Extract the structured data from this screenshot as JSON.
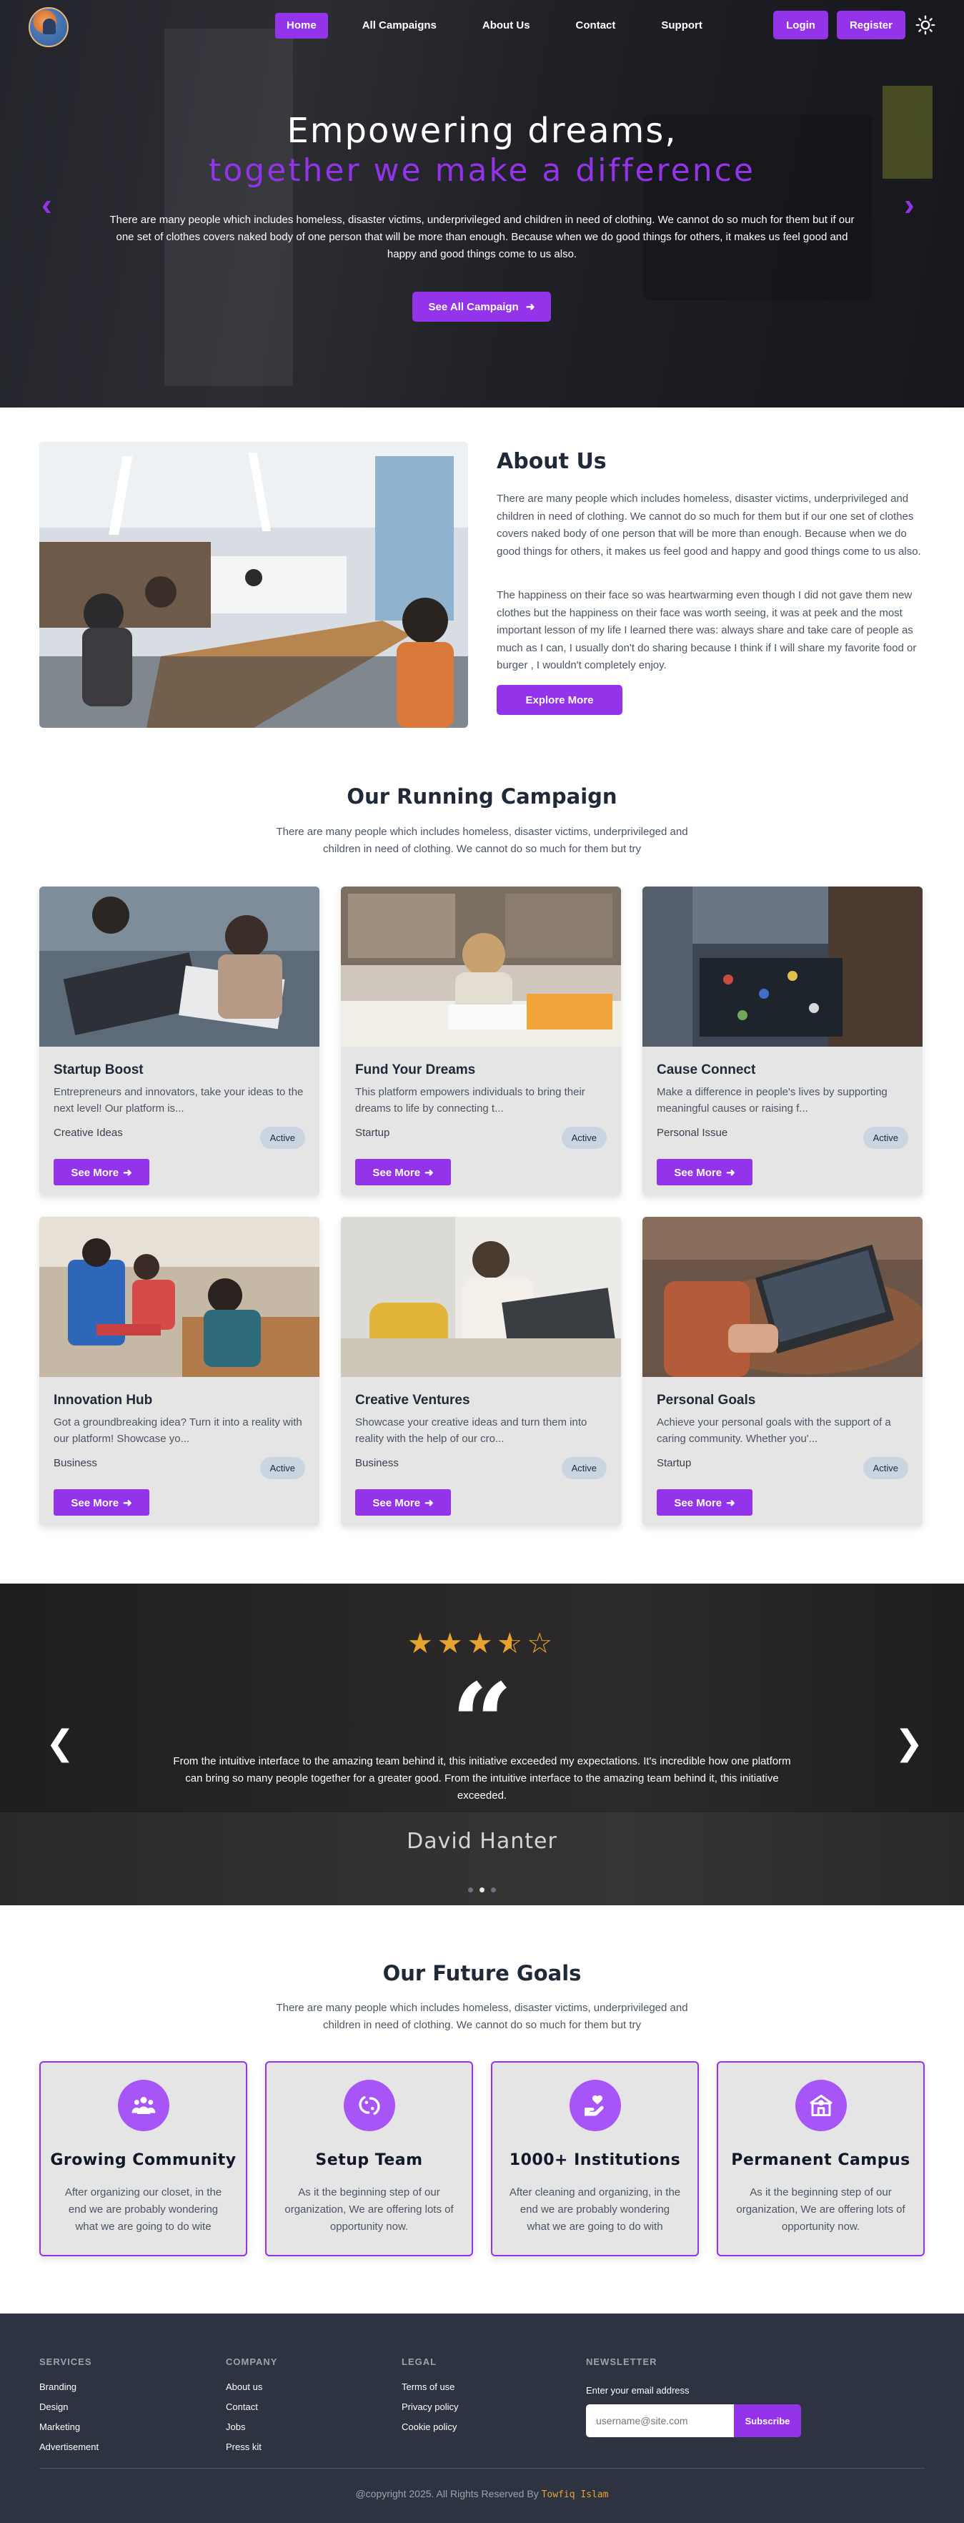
{
  "nav": {
    "links": [
      {
        "label": "Home",
        "active": true
      },
      {
        "label": "All Campaigns",
        "active": false
      },
      {
        "label": "About Us",
        "active": false
      },
      {
        "label": "Contact",
        "active": false
      },
      {
        "label": "Support",
        "active": false
      }
    ],
    "login_label": "Login",
    "register_label": "Register",
    "theme_icon": "sun-icon"
  },
  "hero": {
    "title_line1": "Empowering dreams,",
    "title_line2": "together we make a difference",
    "description": "There are many people which includes homeless, disaster victims, underprivileged and children in need of clothing. We cannot do so much for them but if our one set of clothes covers naked body of one person that will be more than enough. Because when we do good things for others, it makes us feel good and happy and good things come to us also.",
    "button_label": "See All Campaign",
    "prev_icon": "chevron-left-icon",
    "next_icon": "chevron-right-icon"
  },
  "about": {
    "title": "About Us",
    "paragraph1": "There are many people which includes homeless, disaster victims, underprivileged and children in need of clothing. We cannot do so much for them but if our one set of clothes covers naked body of one person that will be more than enough. Because when we do good things for others, it makes us feel good and happy and good things come to us also.",
    "paragraph2": "The happiness on their face so was heartwarming even though I did not gave them new clothes but the happiness on their face was worth seeing, it was at peek and the most important lesson of my life I learned there was: always share and take care of people as much as I can, I usually don't do sharing because I think if I will share my favorite food or burger , I wouldn't completely enjoy.",
    "button_label": "Explore More"
  },
  "campaigns": {
    "title": "Our Running Campaign",
    "subtitle": "There are many people which includes homeless, disaster victims, underprivileged and children in need of clothing. We cannot do so much for them but try",
    "button_label": "See More",
    "items": [
      {
        "title": "Startup Boost",
        "description": "Entrepreneurs and innovators, take your ideas to the next level! Our platform is...",
        "category": "Creative Ideas",
        "status": "Active"
      },
      {
        "title": "Fund Your Dreams",
        "description": "This platform empowers individuals to bring their dreams to life by connecting t...",
        "category": "Startup",
        "status": "Active"
      },
      {
        "title": "Cause Connect",
        "description": "Make a difference in people's lives by supporting meaningful causes or raising f...",
        "category": "Personal Issue",
        "status": "Active"
      },
      {
        "title": "Innovation Hub",
        "description": "Got a groundbreaking idea? Turn it into a reality with our platform! Showcase yo...",
        "category": "Business",
        "status": "Active"
      },
      {
        "title": "Creative Ventures",
        "description": "Showcase your creative ideas and turn them into reality with the help of our cro...",
        "category": "Business",
        "status": "Active"
      },
      {
        "title": "Personal Goals",
        "description": "Achieve your personal goals with the support of a caring community. Whether you'...",
        "category": "Startup",
        "status": "Active"
      }
    ]
  },
  "testimonial": {
    "rating": 3.5,
    "rating_max": 5,
    "text": "From the intuitive interface to the amazing team behind it, this initiative exceeded my expectations. It's incredible how one platform can bring so many people together for a greater good. From the intuitive interface to the amazing team behind it, this initiative exceeded.",
    "name": "David Hanter",
    "slides": 3,
    "active_slide": 2
  },
  "goals": {
    "title": "Our Future Goals",
    "subtitle": "There are many people which includes homeless, disaster victims, underprivileged and children in need of clothing. We cannot do so much for them but try",
    "items": [
      {
        "title": "Growing Community",
        "description": "After organizing our closet, in the end we are probably wondering what we are going to do wite",
        "icon": "community-icon"
      },
      {
        "title": "Setup Team",
        "description": "As it the beginning step of our organization, We are offering lots of opportunity now.",
        "icon": "team-setup-icon"
      },
      {
        "title": "1000+ Institutions",
        "description": "After cleaning and organizing, in the end we are probably wondering what we are going to do with",
        "icon": "heart-hand-icon"
      },
      {
        "title": "Permanent Campus",
        "description": "As it the beginning step of our organization, We are offering lots of opportunity now.",
        "icon": "campus-icon"
      }
    ]
  },
  "footer": {
    "columns": [
      {
        "heading": "SERVICES",
        "links": [
          "Branding",
          "Design",
          "Marketing",
          "Advertisement"
        ]
      },
      {
        "heading": "COMPANY",
        "links": [
          "About us",
          "Contact",
          "Jobs",
          "Press kit"
        ]
      },
      {
        "heading": "LEGAL",
        "links": [
          "Terms of use",
          "Privacy policy",
          "Cookie policy"
        ]
      }
    ],
    "newsletter": {
      "heading": "NEWSLETTER",
      "label": "Enter your email address",
      "placeholder": "username@site.com",
      "button_label": "Subscribe"
    },
    "copyright": "@copyright 2025. All Rights Reserved By",
    "author": "Towfiq Islam"
  },
  "colors": {
    "accent": "#9333ea",
    "star": "#e8a32e",
    "footer_bg": "#2d3340"
  }
}
